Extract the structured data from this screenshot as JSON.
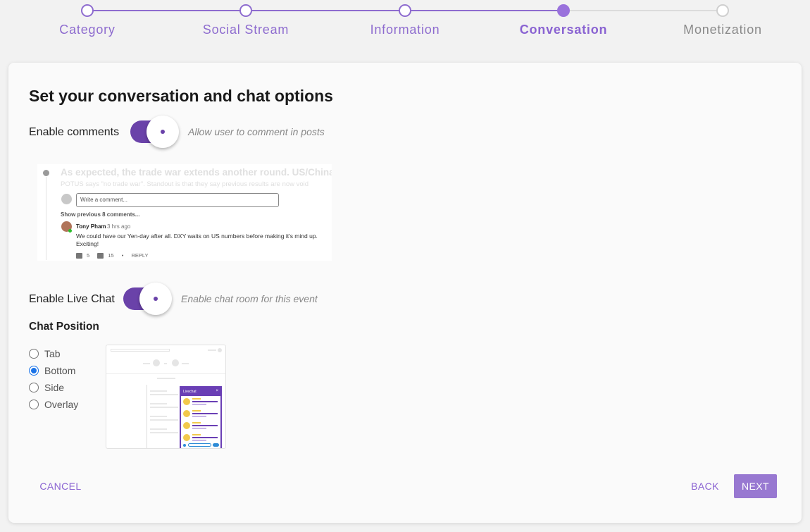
{
  "stepper": {
    "steps": [
      {
        "label": "Category",
        "state": "done"
      },
      {
        "label": "Social Stream",
        "state": "done"
      },
      {
        "label": "Information",
        "state": "done"
      },
      {
        "label": "Conversation",
        "state": "active"
      },
      {
        "label": "Monetization",
        "state": "todo"
      }
    ]
  },
  "page": {
    "title": "Set your conversation and chat options"
  },
  "comments": {
    "label": "Enable comments",
    "enabled": true,
    "hint": "Allow user to comment in posts",
    "preview": {
      "headline": "As expected, the trade war extends another round. US/China",
      "subline": "POTUS says \"no trade war\". Standout is that they say previous results are now void",
      "input_placeholder": "Write a comment...",
      "show_previous": "Show previous 8 comments...",
      "author": "Tony Pham",
      "time": "3 hrs ago",
      "text": "We could have our Yen-day after all. DXY waits on US numbers before making it's mind up. Exciting!",
      "likes": "5",
      "dislikes": "15",
      "separator": "•",
      "reply": "REPLY"
    }
  },
  "live_chat": {
    "label": "Enable Live Chat",
    "enabled": true,
    "hint": "Enable chat room for this event",
    "preview_title": "Livechat",
    "preview_close": "×"
  },
  "chat_position": {
    "title": "Chat Position",
    "options": [
      {
        "label": "Tab",
        "checked": false
      },
      {
        "label": "Bottom",
        "checked": true
      },
      {
        "label": "Side",
        "checked": false
      },
      {
        "label": "Overlay",
        "checked": false
      }
    ]
  },
  "footer": {
    "cancel_label": "CANCEL",
    "back_label": "BACK",
    "next_label": "NEXT"
  },
  "colors": {
    "accent": "#8a63d2",
    "toggle_on": "#6a42a9",
    "next_button": "#9878d1",
    "radio_checked": "#1a73e8"
  }
}
